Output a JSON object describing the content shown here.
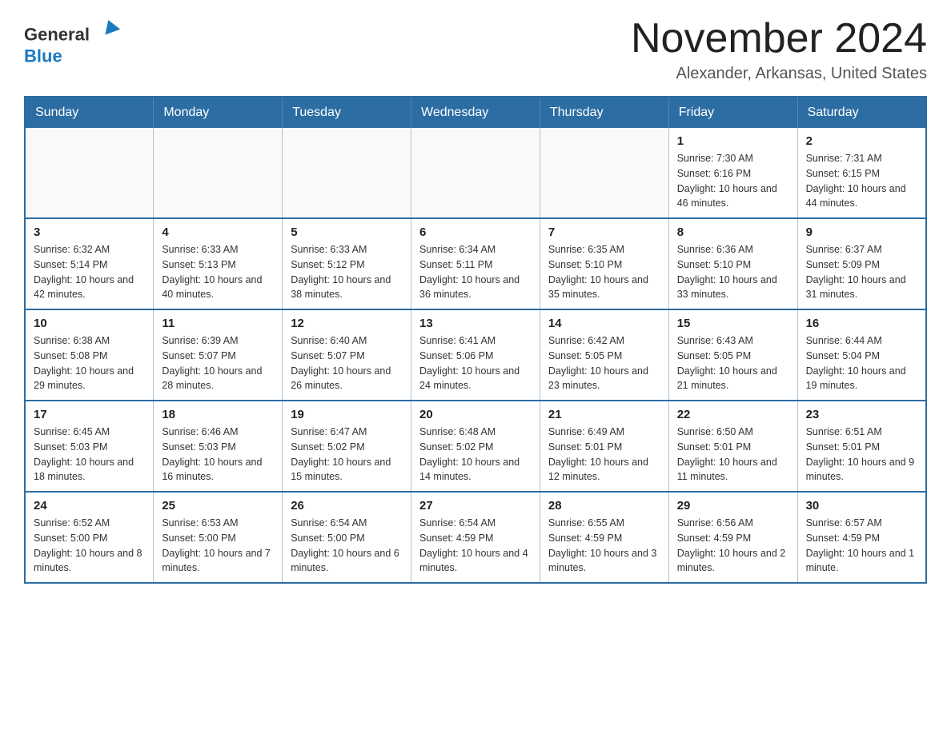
{
  "header": {
    "logo": {
      "general": "General",
      "blue": "Blue"
    },
    "month_title": "November 2024",
    "location": "Alexander, Arkansas, United States"
  },
  "calendar": {
    "days_of_week": [
      "Sunday",
      "Monday",
      "Tuesday",
      "Wednesday",
      "Thursday",
      "Friday",
      "Saturday"
    ],
    "weeks": [
      [
        {
          "day": "",
          "sunrise": "",
          "sunset": "",
          "daylight": ""
        },
        {
          "day": "",
          "sunrise": "",
          "sunset": "",
          "daylight": ""
        },
        {
          "day": "",
          "sunrise": "",
          "sunset": "",
          "daylight": ""
        },
        {
          "day": "",
          "sunrise": "",
          "sunset": "",
          "daylight": ""
        },
        {
          "day": "",
          "sunrise": "",
          "sunset": "",
          "daylight": ""
        },
        {
          "day": "1",
          "sunrise": "Sunrise: 7:30 AM",
          "sunset": "Sunset: 6:16 PM",
          "daylight": "Daylight: 10 hours and 46 minutes."
        },
        {
          "day": "2",
          "sunrise": "Sunrise: 7:31 AM",
          "sunset": "Sunset: 6:15 PM",
          "daylight": "Daylight: 10 hours and 44 minutes."
        }
      ],
      [
        {
          "day": "3",
          "sunrise": "Sunrise: 6:32 AM",
          "sunset": "Sunset: 5:14 PM",
          "daylight": "Daylight: 10 hours and 42 minutes."
        },
        {
          "day": "4",
          "sunrise": "Sunrise: 6:33 AM",
          "sunset": "Sunset: 5:13 PM",
          "daylight": "Daylight: 10 hours and 40 minutes."
        },
        {
          "day": "5",
          "sunrise": "Sunrise: 6:33 AM",
          "sunset": "Sunset: 5:12 PM",
          "daylight": "Daylight: 10 hours and 38 minutes."
        },
        {
          "day": "6",
          "sunrise": "Sunrise: 6:34 AM",
          "sunset": "Sunset: 5:11 PM",
          "daylight": "Daylight: 10 hours and 36 minutes."
        },
        {
          "day": "7",
          "sunrise": "Sunrise: 6:35 AM",
          "sunset": "Sunset: 5:10 PM",
          "daylight": "Daylight: 10 hours and 35 minutes."
        },
        {
          "day": "8",
          "sunrise": "Sunrise: 6:36 AM",
          "sunset": "Sunset: 5:10 PM",
          "daylight": "Daylight: 10 hours and 33 minutes."
        },
        {
          "day": "9",
          "sunrise": "Sunrise: 6:37 AM",
          "sunset": "Sunset: 5:09 PM",
          "daylight": "Daylight: 10 hours and 31 minutes."
        }
      ],
      [
        {
          "day": "10",
          "sunrise": "Sunrise: 6:38 AM",
          "sunset": "Sunset: 5:08 PM",
          "daylight": "Daylight: 10 hours and 29 minutes."
        },
        {
          "day": "11",
          "sunrise": "Sunrise: 6:39 AM",
          "sunset": "Sunset: 5:07 PM",
          "daylight": "Daylight: 10 hours and 28 minutes."
        },
        {
          "day": "12",
          "sunrise": "Sunrise: 6:40 AM",
          "sunset": "Sunset: 5:07 PM",
          "daylight": "Daylight: 10 hours and 26 minutes."
        },
        {
          "day": "13",
          "sunrise": "Sunrise: 6:41 AM",
          "sunset": "Sunset: 5:06 PM",
          "daylight": "Daylight: 10 hours and 24 minutes."
        },
        {
          "day": "14",
          "sunrise": "Sunrise: 6:42 AM",
          "sunset": "Sunset: 5:05 PM",
          "daylight": "Daylight: 10 hours and 23 minutes."
        },
        {
          "day": "15",
          "sunrise": "Sunrise: 6:43 AM",
          "sunset": "Sunset: 5:05 PM",
          "daylight": "Daylight: 10 hours and 21 minutes."
        },
        {
          "day": "16",
          "sunrise": "Sunrise: 6:44 AM",
          "sunset": "Sunset: 5:04 PM",
          "daylight": "Daylight: 10 hours and 19 minutes."
        }
      ],
      [
        {
          "day": "17",
          "sunrise": "Sunrise: 6:45 AM",
          "sunset": "Sunset: 5:03 PM",
          "daylight": "Daylight: 10 hours and 18 minutes."
        },
        {
          "day": "18",
          "sunrise": "Sunrise: 6:46 AM",
          "sunset": "Sunset: 5:03 PM",
          "daylight": "Daylight: 10 hours and 16 minutes."
        },
        {
          "day": "19",
          "sunrise": "Sunrise: 6:47 AM",
          "sunset": "Sunset: 5:02 PM",
          "daylight": "Daylight: 10 hours and 15 minutes."
        },
        {
          "day": "20",
          "sunrise": "Sunrise: 6:48 AM",
          "sunset": "Sunset: 5:02 PM",
          "daylight": "Daylight: 10 hours and 14 minutes."
        },
        {
          "day": "21",
          "sunrise": "Sunrise: 6:49 AM",
          "sunset": "Sunset: 5:01 PM",
          "daylight": "Daylight: 10 hours and 12 minutes."
        },
        {
          "day": "22",
          "sunrise": "Sunrise: 6:50 AM",
          "sunset": "Sunset: 5:01 PM",
          "daylight": "Daylight: 10 hours and 11 minutes."
        },
        {
          "day": "23",
          "sunrise": "Sunrise: 6:51 AM",
          "sunset": "Sunset: 5:01 PM",
          "daylight": "Daylight: 10 hours and 9 minutes."
        }
      ],
      [
        {
          "day": "24",
          "sunrise": "Sunrise: 6:52 AM",
          "sunset": "Sunset: 5:00 PM",
          "daylight": "Daylight: 10 hours and 8 minutes."
        },
        {
          "day": "25",
          "sunrise": "Sunrise: 6:53 AM",
          "sunset": "Sunset: 5:00 PM",
          "daylight": "Daylight: 10 hours and 7 minutes."
        },
        {
          "day": "26",
          "sunrise": "Sunrise: 6:54 AM",
          "sunset": "Sunset: 5:00 PM",
          "daylight": "Daylight: 10 hours and 6 minutes."
        },
        {
          "day": "27",
          "sunrise": "Sunrise: 6:54 AM",
          "sunset": "Sunset: 4:59 PM",
          "daylight": "Daylight: 10 hours and 4 minutes."
        },
        {
          "day": "28",
          "sunrise": "Sunrise: 6:55 AM",
          "sunset": "Sunset: 4:59 PM",
          "daylight": "Daylight: 10 hours and 3 minutes."
        },
        {
          "day": "29",
          "sunrise": "Sunrise: 6:56 AM",
          "sunset": "Sunset: 4:59 PM",
          "daylight": "Daylight: 10 hours and 2 minutes."
        },
        {
          "day": "30",
          "sunrise": "Sunrise: 6:57 AM",
          "sunset": "Sunset: 4:59 PM",
          "daylight": "Daylight: 10 hours and 1 minute."
        }
      ]
    ]
  }
}
